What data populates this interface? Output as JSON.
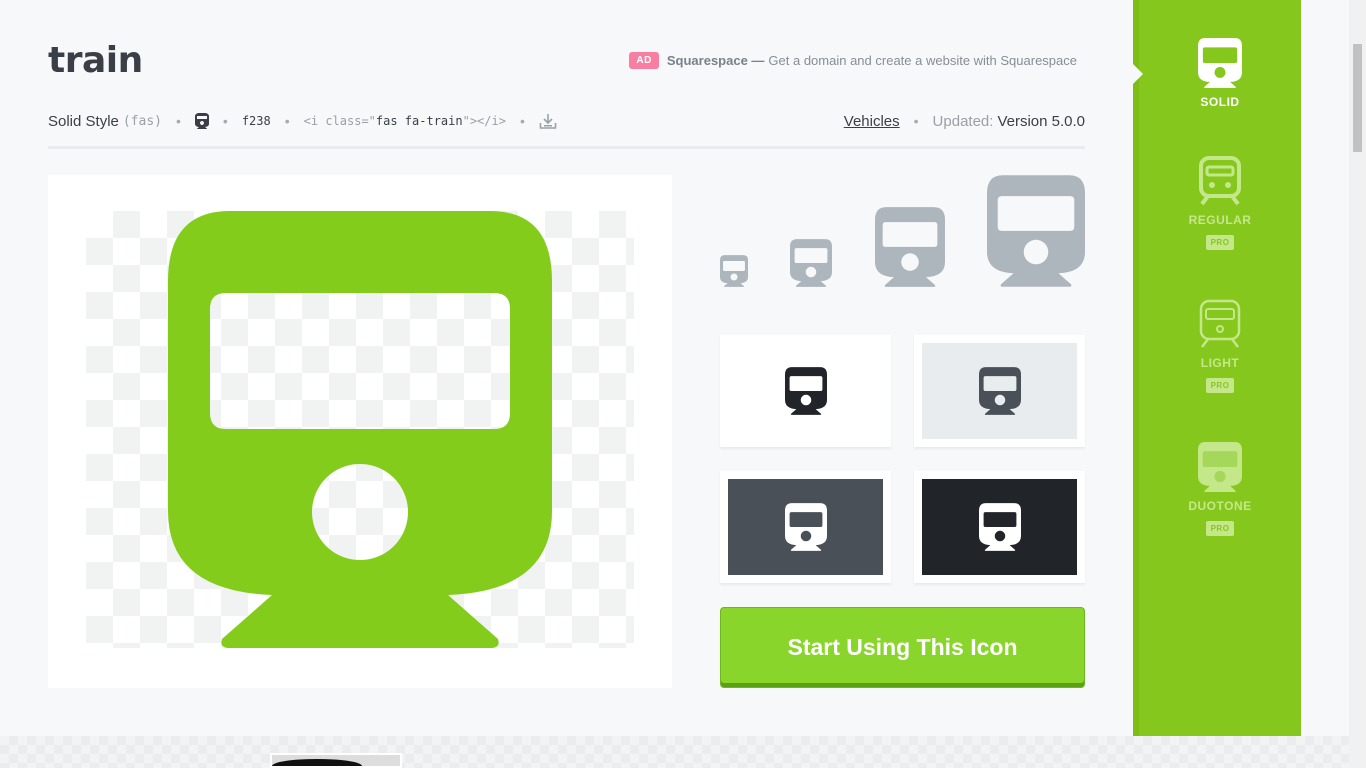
{
  "icon": {
    "name": "train",
    "style_label": "Solid Style",
    "style_prefix": "(fas)",
    "unicode": "f238",
    "html_snippet_open": "<i class=\"",
    "html_snippet_class": "fas fa-train",
    "html_snippet_close": "\"></i>",
    "category": "Vehicles",
    "updated_label": "Updated:",
    "version": "Version 5.0.0"
  },
  "ad": {
    "badge": "AD",
    "brand": "Squarespace —",
    "text": "Get a domain and create a website with Squarespace"
  },
  "cta": {
    "label": "Start Using This Icon"
  },
  "styles": [
    {
      "label": "SOLID",
      "pro": false,
      "active": true
    },
    {
      "label": "REGULAR",
      "pro": true,
      "active": false
    },
    {
      "label": "LIGHT",
      "pro": true,
      "active": false
    },
    {
      "label": "DUOTONE",
      "pro": true,
      "active": false
    }
  ],
  "pro_badge": "PRO",
  "colors": {
    "brand_green": "#85c71d",
    "button_green": "#8ad52b",
    "icon_gray": "#adb5bd",
    "dark": "#212529"
  },
  "icons": {
    "main": "train-icon",
    "download": "download-icon"
  }
}
